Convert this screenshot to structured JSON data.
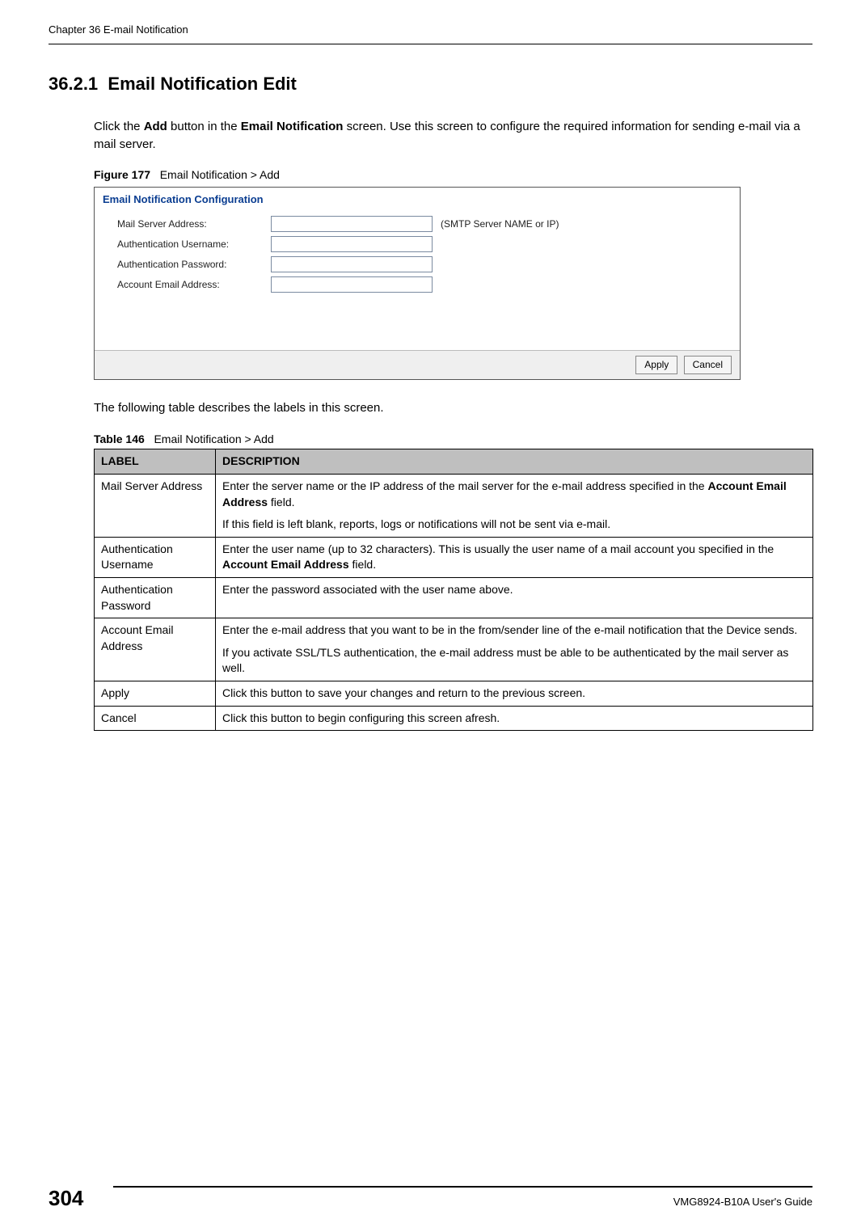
{
  "running_header": "Chapter 36 E-mail Notification",
  "section": {
    "number": "36.2.1",
    "title": "Email Notification Edit"
  },
  "intro_para": "Click the <b>Add</b> button in the <b>Email Notification</b> screen. Use this screen to configure the required information for sending e-mail via a mail server.",
  "figure": {
    "label": "Figure 177",
    "caption": "Email Notification > Add"
  },
  "screenshot": {
    "title": "Email Notification Configuration",
    "rows": [
      {
        "label": "Mail Server Address:",
        "after": "(SMTP Server NAME or IP)"
      },
      {
        "label": "Authentication Username:",
        "after": ""
      },
      {
        "label": "Authentication Password:",
        "after": ""
      },
      {
        "label": "Account Email Address:",
        "after": ""
      }
    ],
    "apply": "Apply",
    "cancel": "Cancel"
  },
  "after_fig_para": "The following table describes the labels in this screen.",
  "table": {
    "label": "Table 146",
    "caption": "Email Notification > Add",
    "headers": {
      "col1": "LABEL",
      "col2": "DESCRIPTION"
    },
    "rows": [
      {
        "label": "Mail Server Address",
        "desc": [
          "Enter the server name or the IP address of the mail server for the e-mail address specified in the <b>Account Email Address</b> field.",
          "If this field is left blank, reports, logs or notifications will not be sent via e-mail."
        ]
      },
      {
        "label": "Authentication Username",
        "desc": [
          "Enter the user name (up to 32 characters). This is usually the user name of a mail account you specified in the <b>Account Email Address</b> field."
        ]
      },
      {
        "label": "Authentication Password",
        "desc": [
          "Enter the password associated with the user name above."
        ]
      },
      {
        "label": "Account Email Address",
        "desc": [
          "Enter the e-mail address that you want to be in the from/sender line of the e-mail notification that the Device sends.",
          "If you activate SSL/TLS authentication, the e-mail address must be able to be authenticated by the mail server as well."
        ]
      },
      {
        "label": "Apply",
        "desc": [
          "Click this button to save your changes and return to the previous screen."
        ]
      },
      {
        "label": "Cancel",
        "desc": [
          "Click this button to begin configuring this screen afresh."
        ]
      }
    ]
  },
  "footer": {
    "page": "304",
    "guide": "VMG8924-B10A User's Guide"
  }
}
